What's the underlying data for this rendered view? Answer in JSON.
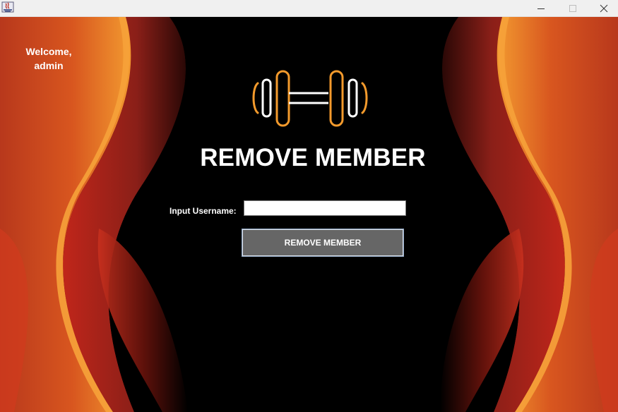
{
  "window": {
    "title": "",
    "controls": {
      "minimize_icon": "minimize-icon",
      "maximize_icon": "maximize-icon",
      "close_icon": "close-icon"
    }
  },
  "sidebar": {
    "welcome_line1": "Welcome,",
    "welcome_line2": "admin"
  },
  "main": {
    "logo_icon": "dumbbell-icon",
    "title": "REMOVE MEMBER",
    "username_label": "Input Username:",
    "username_value": "",
    "submit_label": "REMOVE MEMBER"
  },
  "colors": {
    "background": "#000000",
    "accent_orange": "#f39a2c",
    "accent_red": "#c0261c",
    "button_bg": "#666666",
    "text": "#ffffff"
  }
}
